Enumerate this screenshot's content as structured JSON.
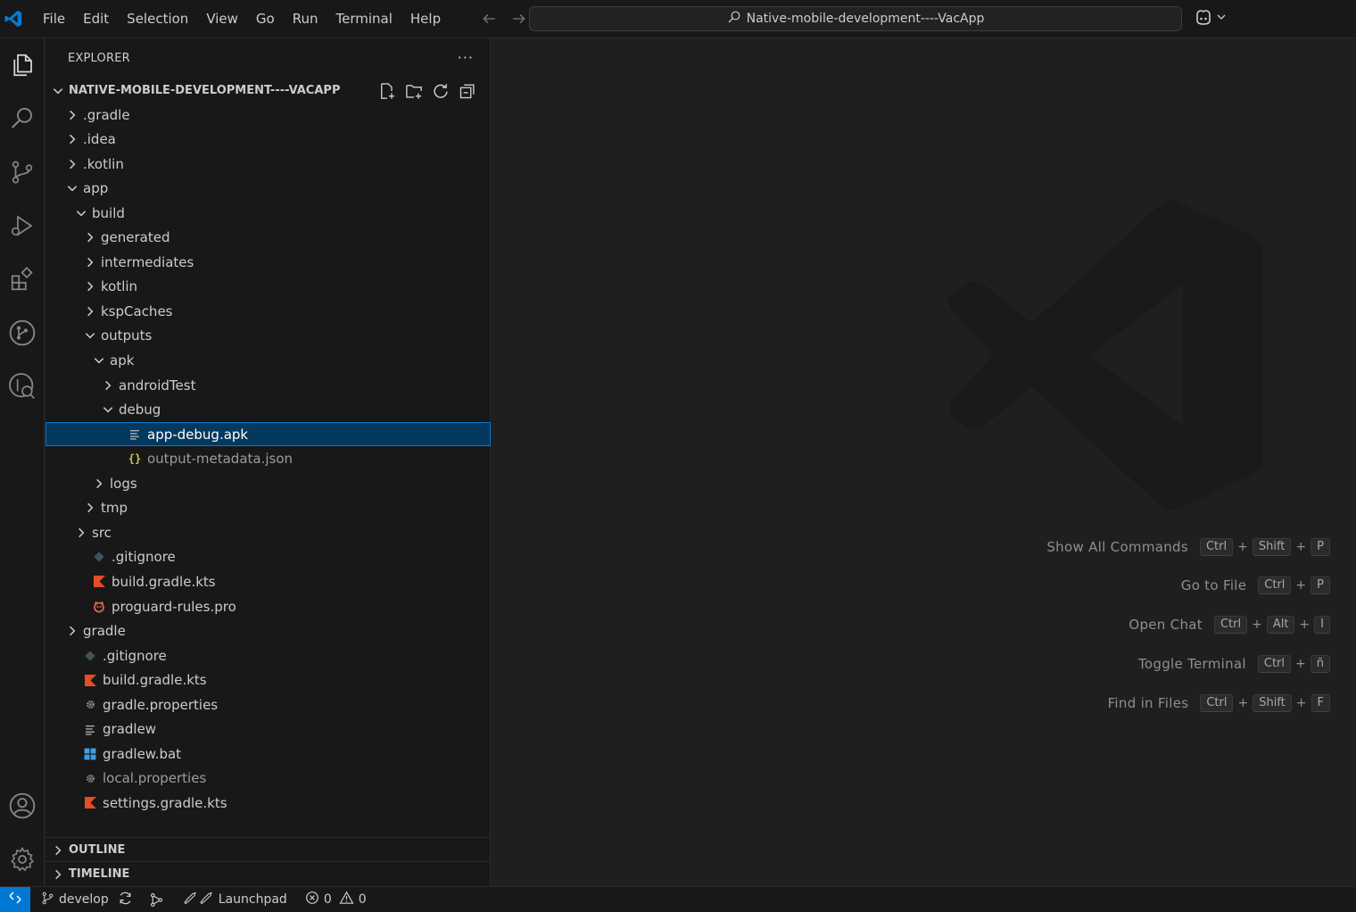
{
  "menu": [
    "File",
    "Edit",
    "Selection",
    "View",
    "Go",
    "Run",
    "Terminal",
    "Help"
  ],
  "command_center": {
    "text": "Native-mobile-development----VacApp"
  },
  "sidebar": {
    "title": "EXPLORER",
    "more": "···",
    "root": "NATIVE-MOBILE-DEVELOPMENT----VACAPP",
    "tree": [
      {
        "label": ".gradle",
        "depth": 0,
        "type": "folder",
        "expanded": false
      },
      {
        "label": ".idea",
        "depth": 0,
        "type": "folder",
        "expanded": false
      },
      {
        "label": ".kotlin",
        "depth": 0,
        "type": "folder",
        "expanded": false
      },
      {
        "label": "app",
        "depth": 0,
        "type": "folder",
        "expanded": true
      },
      {
        "label": "build",
        "depth": 1,
        "type": "folder",
        "expanded": true
      },
      {
        "label": "generated",
        "depth": 2,
        "type": "folder",
        "expanded": false
      },
      {
        "label": "intermediates",
        "depth": 2,
        "type": "folder",
        "expanded": false
      },
      {
        "label": "kotlin",
        "depth": 2,
        "type": "folder",
        "expanded": false
      },
      {
        "label": "kspCaches",
        "depth": 2,
        "type": "folder",
        "expanded": false
      },
      {
        "label": "outputs",
        "depth": 2,
        "type": "folder",
        "expanded": true
      },
      {
        "label": "apk",
        "depth": 3,
        "type": "folder",
        "expanded": true
      },
      {
        "label": "androidTest",
        "depth": 4,
        "type": "folder",
        "expanded": false
      },
      {
        "label": "debug",
        "depth": 4,
        "type": "folder",
        "expanded": true
      },
      {
        "label": "app-debug.apk",
        "depth": 5,
        "type": "file",
        "icon": "lines-icon",
        "selected": true
      },
      {
        "label": "output-metadata.json",
        "depth": 5,
        "type": "file",
        "icon": "json-icon",
        "dim": true
      },
      {
        "label": "logs",
        "depth": 3,
        "type": "folder",
        "expanded": false
      },
      {
        "label": "tmp",
        "depth": 2,
        "type": "folder",
        "expanded": false
      },
      {
        "label": "src",
        "depth": 1,
        "type": "folder",
        "expanded": false
      },
      {
        "label": ".gitignore",
        "depth": 1,
        "type": "file",
        "icon": "git-icon"
      },
      {
        "label": "build.gradle.kts",
        "depth": 1,
        "type": "file",
        "icon": "kotlin-icon"
      },
      {
        "label": "proguard-rules.pro",
        "depth": 1,
        "type": "file",
        "icon": "proguard-icon"
      },
      {
        "label": "gradle",
        "depth": 0,
        "type": "folder",
        "expanded": false
      },
      {
        "label": ".gitignore",
        "depth": 0,
        "type": "file",
        "icon": "git-icon"
      },
      {
        "label": "build.gradle.kts",
        "depth": 0,
        "type": "file",
        "icon": "kotlin-icon"
      },
      {
        "label": "gradle.properties",
        "depth": 0,
        "type": "file",
        "icon": "gear-file-icon"
      },
      {
        "label": "gradlew",
        "depth": 0,
        "type": "file",
        "icon": "lines-icon"
      },
      {
        "label": "gradlew.bat",
        "depth": 0,
        "type": "file",
        "icon": "windows-icon"
      },
      {
        "label": "local.properties",
        "depth": 0,
        "type": "file",
        "icon": "gear-file-icon",
        "dim": true
      },
      {
        "label": "settings.gradle.kts",
        "depth": 0,
        "type": "file",
        "icon": "kotlin-icon"
      }
    ],
    "outline": "OUTLINE",
    "timeline": "TIMELINE"
  },
  "shortcuts": [
    {
      "label": "Show All Commands",
      "keys": [
        "Ctrl",
        "Shift",
        "P"
      ]
    },
    {
      "label": "Go to File",
      "keys": [
        "Ctrl",
        "P"
      ]
    },
    {
      "label": "Open Chat",
      "keys": [
        "Ctrl",
        "Alt",
        "I"
      ]
    },
    {
      "label": "Toggle Terminal",
      "keys": [
        "Ctrl",
        "ñ"
      ]
    },
    {
      "label": "Find in Files",
      "keys": [
        "Ctrl",
        "Shift",
        "F"
      ]
    }
  ],
  "statusbar": {
    "branch": "develop",
    "launchpad": "Launchpad",
    "errors": "0",
    "warnings": "0"
  },
  "colors": {
    "accent": "#0078d4",
    "selection": "#04395e",
    "kotlin": "#e44d26",
    "json": "#cbcb41",
    "windows": "#3c9ee6"
  }
}
